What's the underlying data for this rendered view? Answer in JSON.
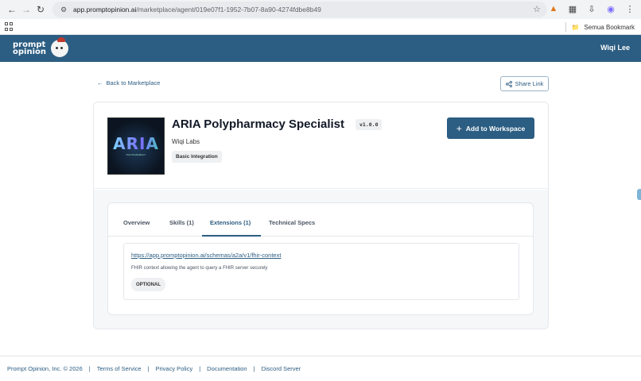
{
  "browser": {
    "url_domain": "app.promptopinion.ai",
    "url_path": "/marketplace/agent/019e07f1-1952-7b07-8a90-4274fdbe8b49",
    "bookmark_folder": "Semua Bookmark"
  },
  "header": {
    "logo_line1": "prompt",
    "logo_line2": "opinion",
    "user_name": "Wiqi Lee"
  },
  "nav": {
    "back_label": "Back to Marketplace",
    "share_label": "Share Link"
  },
  "agent": {
    "thumbnail_title": "ARIA",
    "thumbnail_subtitle": "POLYPHARMACY",
    "title": "ARIA Polypharmacy Specialist",
    "version": "v1.0.0",
    "org": "Wiqi Labs",
    "integration_badge": "Basic Integration",
    "add_button": "Add to Workspace"
  },
  "tabs": [
    {
      "label": "Overview",
      "active": false
    },
    {
      "label": "Skills (1)",
      "active": false
    },
    {
      "label": "Extensions (1)",
      "active": true
    },
    {
      "label": "Technical Specs",
      "active": false
    }
  ],
  "extension": {
    "url": "https://app.promptopinion.ai/schemas/a2a/v1/fhir-context",
    "description": "FHIR context allowing the agent to query a FHIR server securely",
    "badge": "OPTIONAL"
  },
  "footer": {
    "copyright": "Prompt Opinion, Inc. © 2026",
    "links": [
      "Terms of Service",
      "Privacy Policy",
      "Documentation",
      "Discord Server"
    ]
  },
  "colors": {
    "brand": "#2c5d82",
    "page_bg": "#ffffff",
    "panel_bg": "#f6f7f9"
  }
}
